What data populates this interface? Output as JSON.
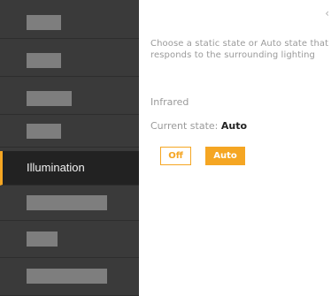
{
  "sidebar": {
    "items": [
      {
        "label": ""
      },
      {
        "label": ""
      },
      {
        "label": ""
      },
      {
        "label": ""
      },
      {
        "label": "Illumination"
      },
      {
        "label": ""
      },
      {
        "label": ""
      },
      {
        "label": ""
      }
    ]
  },
  "main": {
    "chevron_icon": "chevron-left-icon",
    "description": "Choose a static state or Auto state that responds to the surrounding lighting",
    "section_title": "Infrared",
    "current_state_label": "Current state:",
    "current_state_value": "Auto",
    "buttons": {
      "off_label": "Off",
      "auto_label": "Auto"
    }
  },
  "colors": {
    "accent": "#f5a623",
    "sidebar_bg": "#3a3a3a",
    "sidebar_active_bg": "#222222"
  }
}
